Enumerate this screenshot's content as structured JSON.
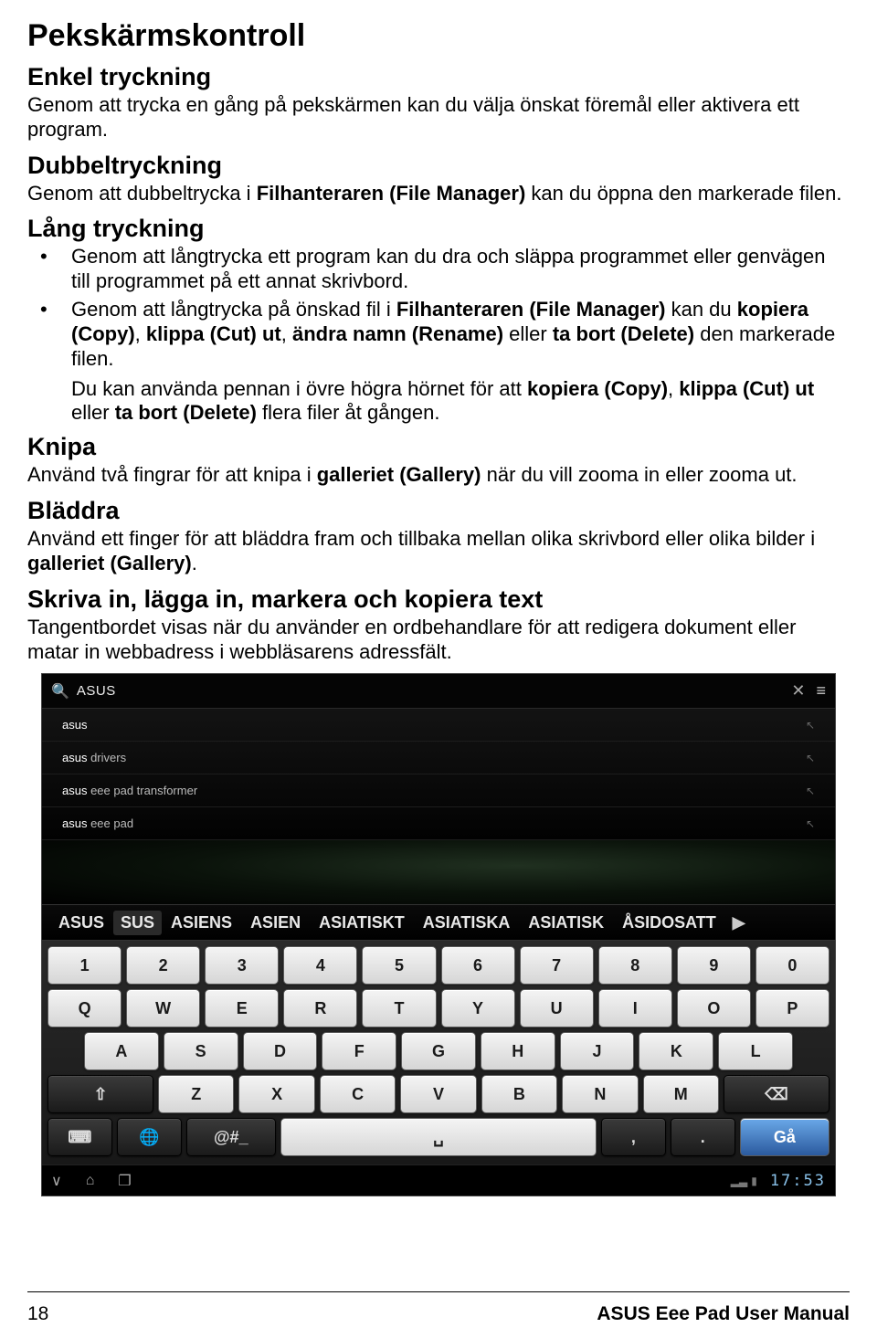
{
  "title": "Pekskärmskontroll",
  "sections": {
    "enkel": {
      "heading": "Enkel tryckning",
      "body": "Genom att trycka en gång på pekskärmen kan du välja önskat föremål eller aktivera ett program."
    },
    "dubbel": {
      "heading": "Dubbeltryckning",
      "body_pre": "Genom att dubbeltrycka i ",
      "body_bold": "Filhanteraren (File Manager)",
      "body_post": " kan du öppna den markerade filen."
    },
    "lang": {
      "heading": "Lång tryckning",
      "b1": "Genom att långtrycka ett program kan du dra och släppa programmet eller genvägen till programmet på ett annat skrivbord.",
      "b2_pre": "Genom att långtrycka på önskad fil i ",
      "b2_b1": "Filhanteraren (File Manager)",
      "b2_mid1": " kan du ",
      "b2_b2": "kopiera (Copy)",
      "b2_mid2": ", ",
      "b2_b3": "klippa (Cut) ut",
      "b2_mid3": ", ",
      "b2_b4": "ändra namn (Rename)",
      "b2_mid4": " eller ",
      "b2_b5": "ta bort (Delete)",
      "b2_post": " den markerade filen.",
      "note_pre": "Du kan använda pennan i övre högra hörnet för att ",
      "note_b1": "kopiera (Copy)",
      "note_mid1": ", ",
      "note_b2": "klippa (Cut) ut",
      "note_mid2": " eller ",
      "note_b3": "ta bort (Delete)",
      "note_post": " flera filer åt gången."
    },
    "knipa": {
      "heading": "Knipa",
      "body_pre": "Använd två fingrar för att knipa i ",
      "body_bold": "galleriet (Gallery)",
      "body_post": " när du vill zooma in eller zooma ut."
    },
    "bladdra": {
      "heading": "Bläddra",
      "body_pre": "Använd ett finger för att bläddra fram och tillbaka mellan olika skrivbord eller olika bilder i ",
      "body_bold": "galleriet (Gallery)",
      "body_post": "."
    },
    "skriva": {
      "heading": "Skriva in, lägga in, markera och kopiera text",
      "body": "Tangentbordet visas när du använder en ordbehandlare för att redigera dokument eller matar in webbadress i webbläsarens adressfält."
    }
  },
  "device": {
    "search_query": "ASUS",
    "suggestions": [
      {
        "pre": "",
        "hl": "asus",
        "post": ""
      },
      {
        "pre": "",
        "hl": "asus",
        "post": " drivers"
      },
      {
        "pre": "",
        "hl": "asus",
        "post": " eee pad transformer"
      },
      {
        "pre": "",
        "hl": "asus",
        "post": " eee pad"
      }
    ],
    "predictions": [
      "ASUS",
      "SUS",
      "ASIENS",
      "ASIEN",
      "ASIATISKT",
      "ASIATISKA",
      "ASIATISK",
      "ÅSIDOSATT"
    ],
    "selected_prediction_index": 1,
    "keyboard": {
      "row1": [
        "1",
        "2",
        "3",
        "4",
        "5",
        "6",
        "7",
        "8",
        "9",
        "0"
      ],
      "row2": [
        "Q",
        "W",
        "E",
        "R",
        "T",
        "Y",
        "U",
        "I",
        "O",
        "P"
      ],
      "row3": [
        "A",
        "S",
        "D",
        "F",
        "G",
        "H",
        "J",
        "K",
        "L"
      ],
      "row4_shift": "⇧",
      "row4": [
        "Z",
        "X",
        "C",
        "V",
        "B",
        "N",
        "M"
      ],
      "row4_back": "⌫",
      "row5_kbd": "⌨",
      "row5_globe": "🌐",
      "row5_sym": "@#_",
      "row5_space": "␣",
      "row5_comma": ",",
      "row5_period": ".",
      "row5_go": "Gå"
    },
    "navbar": {
      "back": "∨",
      "home": "⌂",
      "recent": "❐",
      "clock": "17:53"
    }
  },
  "footer": {
    "page": "18",
    "manual": "ASUS Eee Pad User Manual"
  }
}
